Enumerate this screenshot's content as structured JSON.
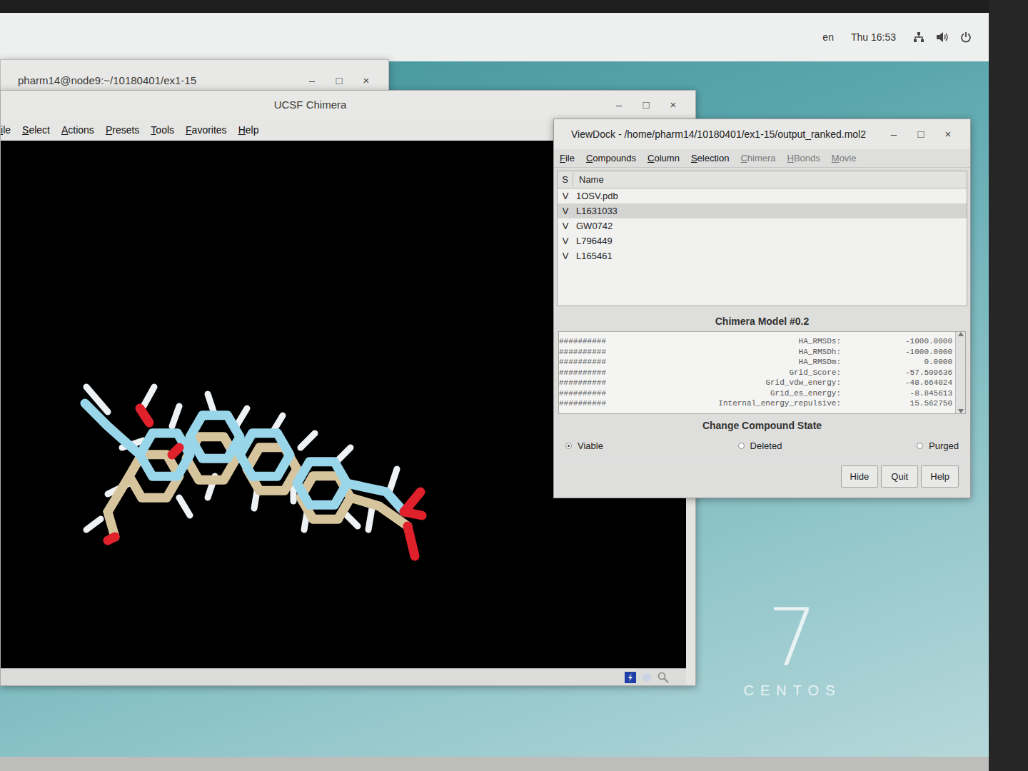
{
  "top_bar": {
    "language": "en",
    "clock": "Thu 16:53"
  },
  "terminal": {
    "title": "pharm14@node9:~/10180401/ex1-15",
    "controls": [
      "–",
      "□",
      "×"
    ]
  },
  "chimera": {
    "title": "UCSF Chimera",
    "controls": [
      "–",
      "□",
      "×"
    ],
    "menu": [
      "ile",
      "Select",
      "Actions",
      "Presets",
      "Tools",
      "Favorites",
      "Help"
    ]
  },
  "viewdock": {
    "title": "ViewDock - /home/pharm14/10180401/ex1-15/output_ranked.mol2",
    "controls": [
      "–",
      "□",
      "×"
    ],
    "menu": [
      {
        "label": "File",
        "disabled": false
      },
      {
        "label": "Compounds",
        "disabled": false
      },
      {
        "label": "Column",
        "disabled": false
      },
      {
        "label": "Selection",
        "disabled": false
      },
      {
        "label": "Chimera",
        "disabled": true
      },
      {
        "label": "HBonds",
        "disabled": true
      },
      {
        "label": "Movie",
        "disabled": true
      }
    ],
    "columns": [
      "S",
      "Name"
    ],
    "rows": [
      {
        "state": "V",
        "name": "1OSV.pdb",
        "selected": false
      },
      {
        "state": "V",
        "name": "L1631033",
        "selected": true
      },
      {
        "state": "V",
        "name": "GW0742",
        "selected": false
      },
      {
        "state": "V",
        "name": "L796449",
        "selected": false
      },
      {
        "state": "V",
        "name": "L165461",
        "selected": false
      }
    ],
    "detail": {
      "title": "Chimera Model #0.2",
      "lines": [
        {
          "hash": "##########",
          "key": "HA_RMSDs:",
          "value": "-1000.0000"
        },
        {
          "hash": "##########",
          "key": "HA_RMSDh:",
          "value": "-1000.0000"
        },
        {
          "hash": "##########",
          "key": "HA_RMSDm:",
          "value": "0.0000"
        },
        {
          "hash": "##########",
          "key": "Grid_Score:",
          "value": "-57.509636"
        },
        {
          "hash": "##########",
          "key": "Grid_vdw_energy:",
          "value": "-48.664024"
        },
        {
          "hash": "##########",
          "key": "Grid_es_energy:",
          "value": "-8.845613"
        },
        {
          "hash": "##########",
          "key": "Internal_energy_repulsive:",
          "value": "15.562750"
        }
      ]
    },
    "state_group": {
      "title": "Change Compound State",
      "options": [
        {
          "label": "Viable",
          "selected": true
        },
        {
          "label": "Deleted",
          "selected": false
        },
        {
          "label": "Purged",
          "selected": false
        }
      ]
    },
    "buttons": [
      "Hide",
      "Quit",
      "Help"
    ]
  },
  "logo": {
    "number": "7",
    "text": "CENTOS"
  }
}
